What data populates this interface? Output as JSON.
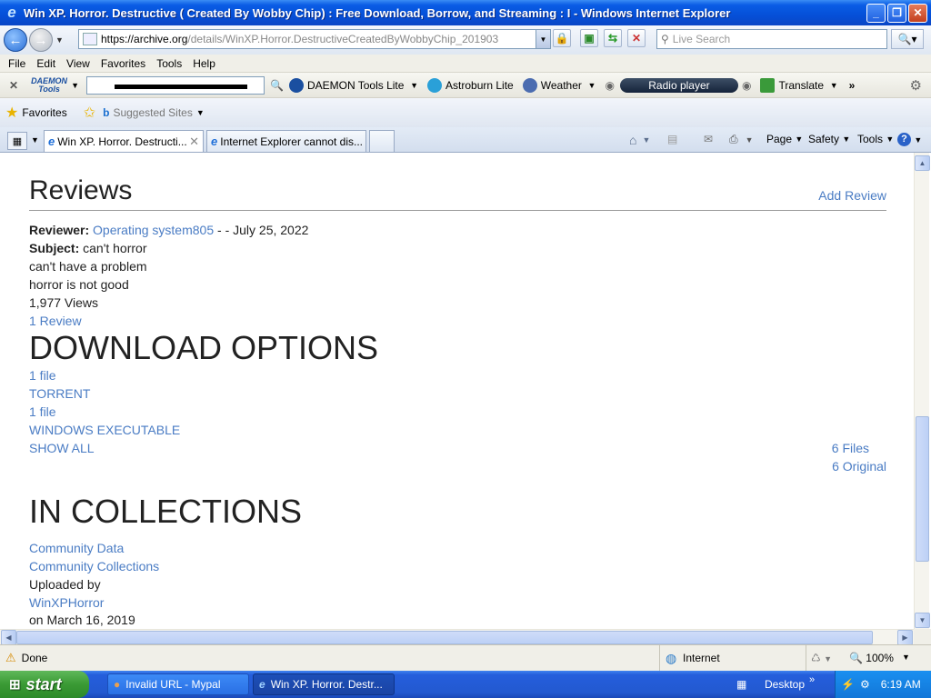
{
  "window": {
    "title": "Win XP. Horror. Destructive ( Created By Wobby Chip) : Free Download, Borrow, and Streaming : I - Windows Internet Explorer"
  },
  "address": {
    "scheme": "https://",
    "host": "archive.org",
    "path": "/details/WinXP.Horror.DestructiveCreatedByWobbyChip_201903"
  },
  "search": {
    "placeholder": "Live Search"
  },
  "menu": {
    "file": "File",
    "edit": "Edit",
    "view": "View",
    "favorites": "Favorites",
    "tools": "Tools",
    "help": "Help"
  },
  "toolbar": {
    "daemon_logo_1": "DAEMON",
    "daemon_logo_2": "Tools",
    "daemon_tools_lite": "DAEMON Tools Lite",
    "astroburn": "Astroburn Lite",
    "weather": "Weather",
    "radio_player": "Radio player",
    "translate": "Translate"
  },
  "favbar": {
    "favorites": "Favorites",
    "suggested_sites": "Suggested Sites"
  },
  "tabs": [
    {
      "label": "Win XP. Horror. Destructi..."
    },
    {
      "label": "Internet Explorer cannot dis..."
    }
  ],
  "commandbar": {
    "page": "Page",
    "safety": "Safety",
    "tools": "Tools"
  },
  "content": {
    "reviews_heading": "Reviews",
    "add_review": "Add Review",
    "reviewer_label": "Reviewer:",
    "reviewer_name": "Operating system805",
    "review_date": " - - July 25, 2022",
    "subject_label": "Subject:",
    "subject_text": " can't horror",
    "body_line1": "can't have a problem",
    "body_line2": "horror is not good",
    "views": "1,977 Views",
    "review_count": "1 Review",
    "download_heading": "DOWNLOAD OPTIONS",
    "dl_count1": "1 file",
    "dl_torrent": "TORRENT",
    "dl_count2": "1 file",
    "dl_exe": "WINDOWS EXECUTABLE",
    "show_all": "SHOW ALL",
    "files_count": "6 Files",
    "original_count": "6 Original",
    "collections_heading": "IN COLLECTIONS",
    "collection1": "Community Data",
    "collection2": "Community Collections",
    "uploaded_by": "Uploaded by",
    "uploader": "WinXPHorror",
    "upload_date": "on March 16, 2019"
  },
  "status": {
    "text": "Done",
    "zone": "Internet",
    "zoom": "100%"
  },
  "taskbar": {
    "start": "start",
    "task1": "Invalid URL - Mypal",
    "task2": "Win XP. Horror. Destr...",
    "desktop": "Desktop",
    "clock": "6:19 AM"
  }
}
